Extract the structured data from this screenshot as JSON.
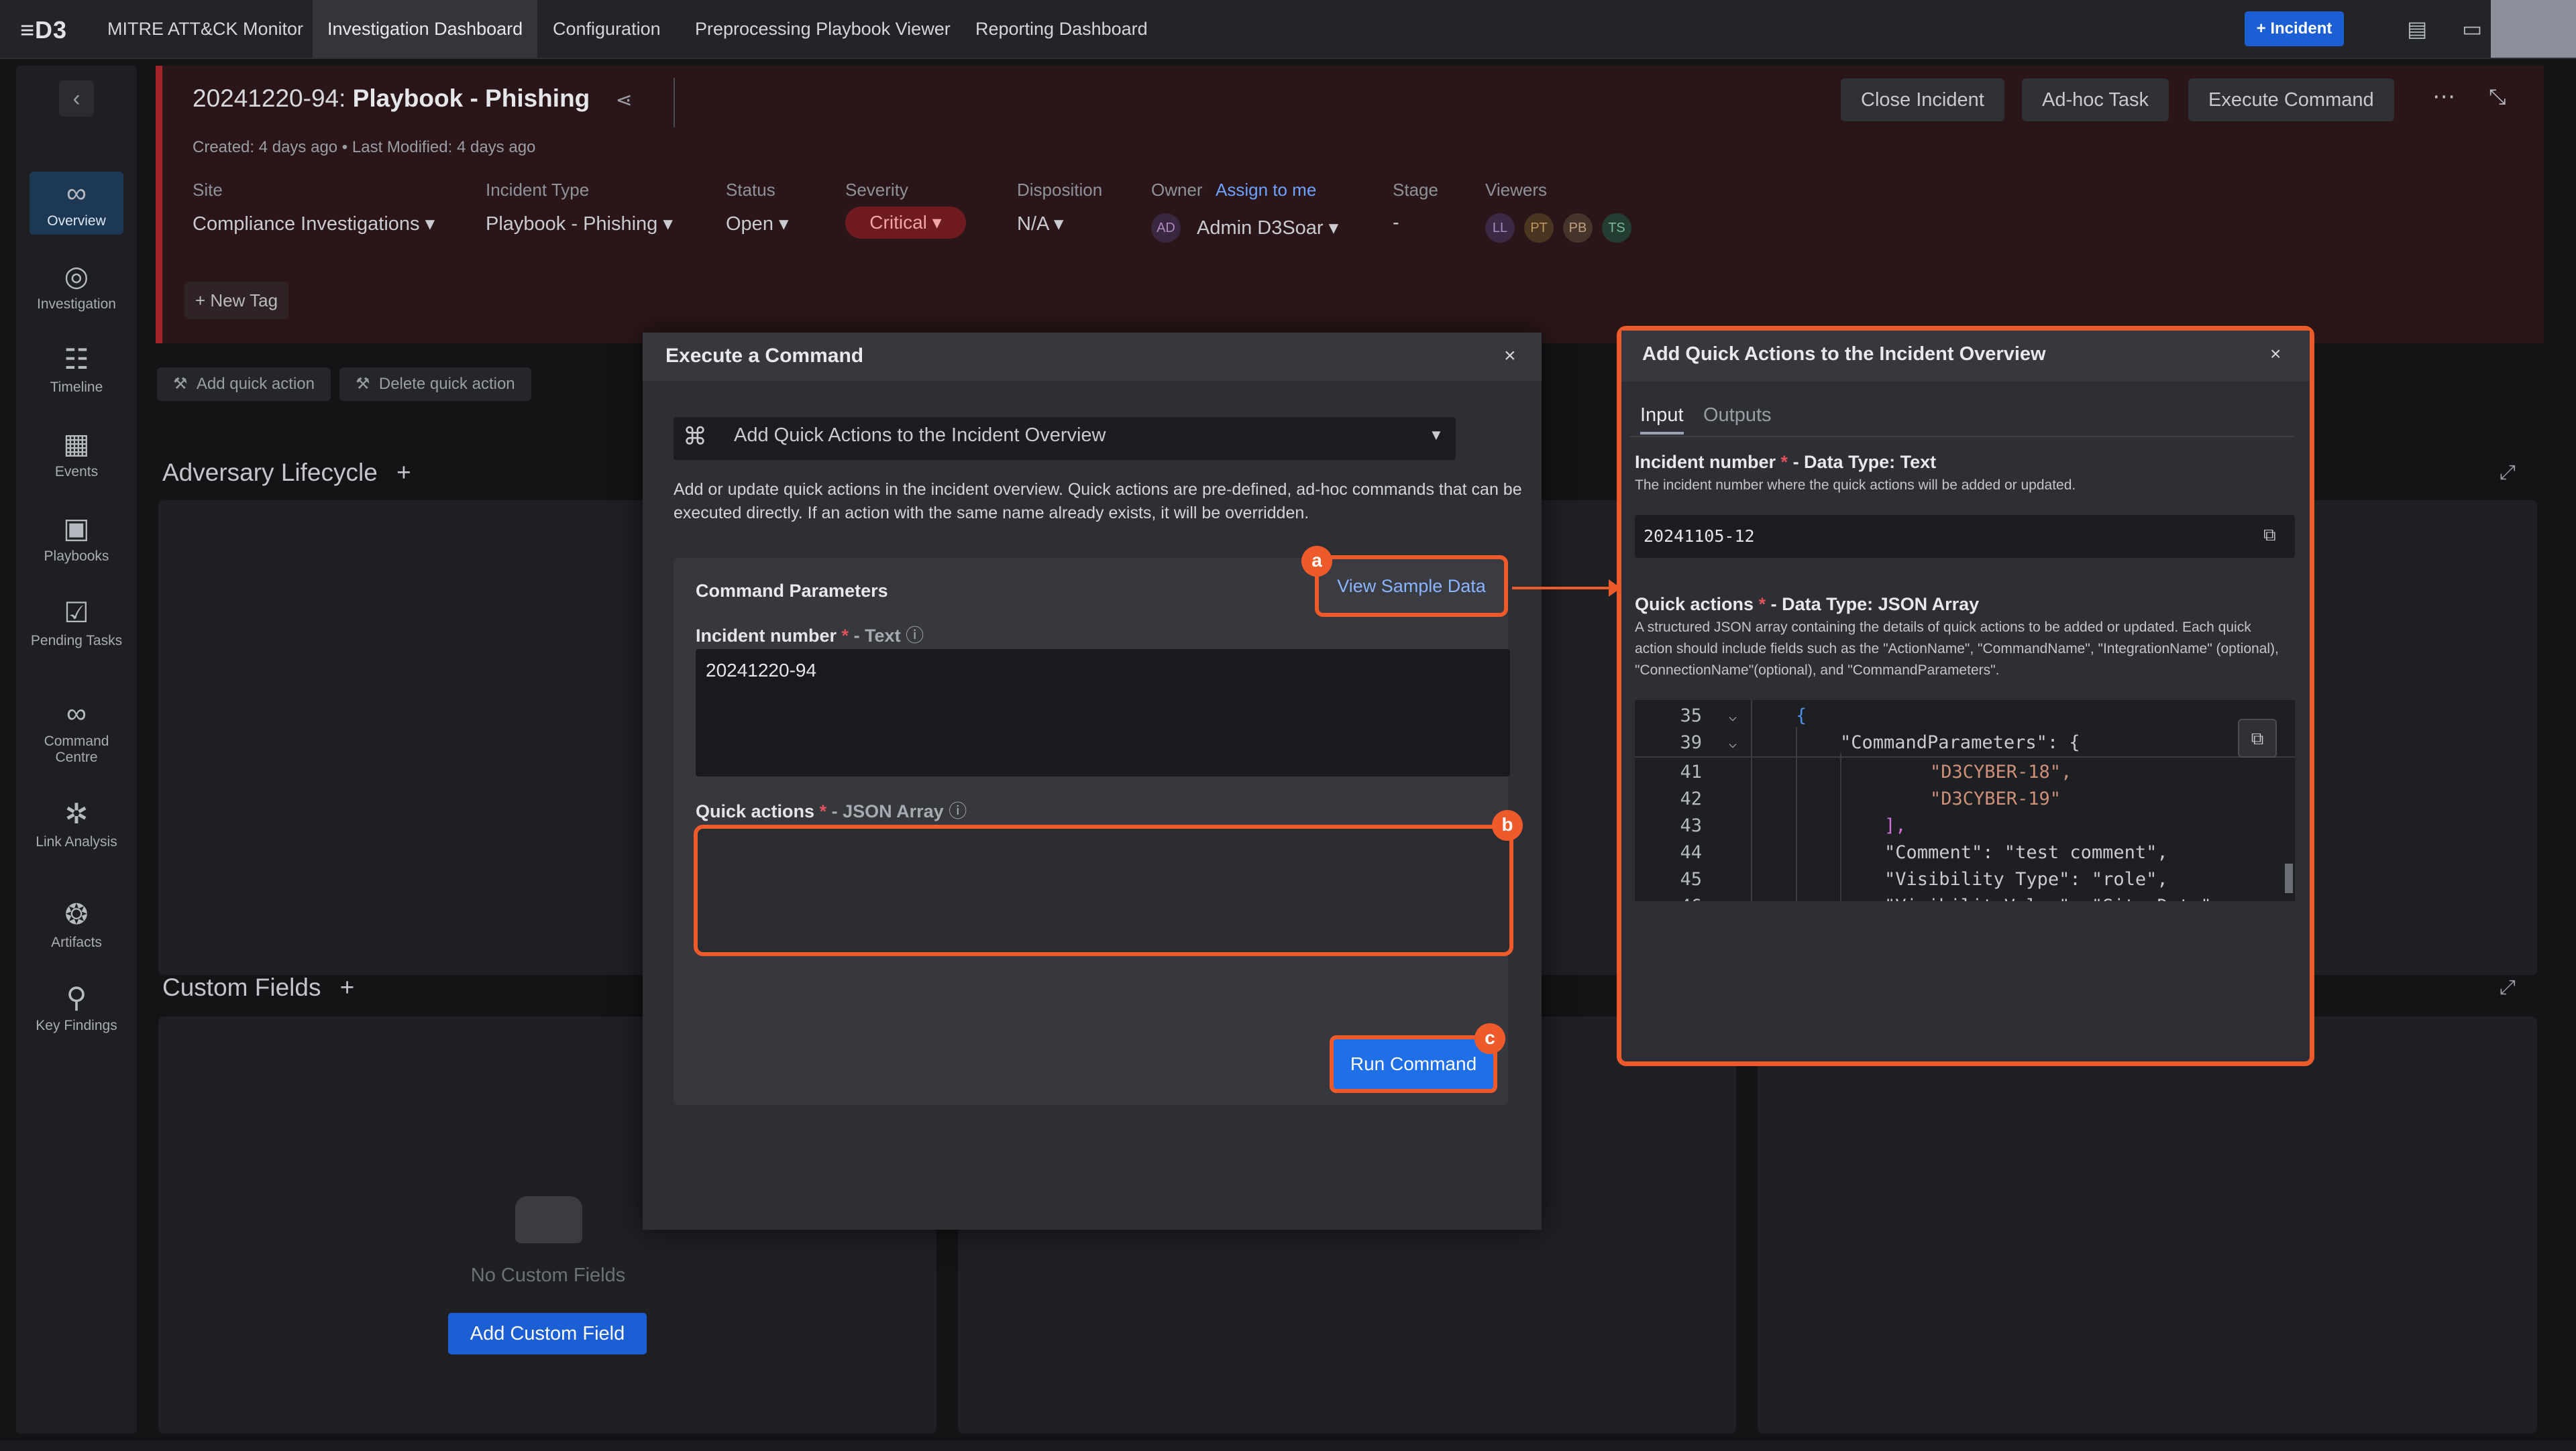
{
  "nav": {
    "logo": "≡D3",
    "tabs": [
      {
        "label": "MITRE ATT&CK Monitor"
      },
      {
        "label": "Investigation Dashboard"
      },
      {
        "label": "Configuration"
      },
      {
        "label": "Preprocessing Playbook Viewer"
      },
      {
        "label": "Reporting Dashboard"
      }
    ],
    "incident_button": "+ Incident"
  },
  "sidebar": {
    "items": [
      {
        "label": "Overview",
        "icon": "binoculars-icon"
      },
      {
        "label": "Investigation",
        "icon": "target-icon"
      },
      {
        "label": "Timeline",
        "icon": "timeline-icon"
      },
      {
        "label": "Events",
        "icon": "calendar-icon"
      },
      {
        "label": "Playbooks",
        "icon": "playbook-icon"
      },
      {
        "label": "Pending Tasks",
        "icon": "checklist-icon"
      },
      {
        "label": "Command Centre",
        "icon": "binoculars-icon"
      },
      {
        "label": "Link Analysis",
        "icon": "network-icon"
      },
      {
        "label": "Artifacts",
        "icon": "fingerprint-icon"
      },
      {
        "label": "Key Findings",
        "icon": "magnifier-icon"
      }
    ]
  },
  "incident": {
    "id": "20241220-94:",
    "name": "Playbook - Phishing",
    "created": "Created:  4 days ago  •  Last Modified:  4 days ago",
    "fields": {
      "site_label": "Site",
      "site_value": "Compliance Investigations",
      "type_label": "Incident Type",
      "type_value": "Playbook - Phishing",
      "status_label": "Status",
      "status_value": "Open",
      "severity_label": "Severity",
      "severity_value": "Critical",
      "disposition_label": "Disposition",
      "disposition_value": "N/A",
      "owner_label": "Owner",
      "assign_link": "Assign to me",
      "owner_initials": "AD",
      "owner_value": "Admin D3Soar",
      "stage_label": "Stage",
      "stage_value": "-",
      "viewers_label": "Viewers"
    },
    "viewers": [
      "LL",
      "PT",
      "PB",
      "TS"
    ],
    "buttons": {
      "close": "Close Incident",
      "adhoc": "Ad-hoc Task",
      "execute": "Execute Command"
    },
    "new_tag": "+ New Tag",
    "quick_actions": {
      "add": "Add quick action",
      "delete": "Delete quick action"
    }
  },
  "sections": {
    "adversary": "Adversary Lifecycle",
    "custom_fields": "Custom Fields",
    "no_custom_fields": "No Custom Fields",
    "add_custom_field": "Add Custom Field"
  },
  "execute_modal": {
    "title": "Execute a Command",
    "command": "Add Quick Actions to the Incident Overview",
    "description": "Add or update quick actions in the incident overview. Quick actions are pre-defined, ad-hoc commands that can be executed directly. If an action with the same name already exists, it will be overridden.",
    "params_title": "Command Parameters",
    "view_sample": "View Sample Data",
    "incident_label": "Incident number",
    "incident_type": "- Text",
    "incident_value": "20241220-94",
    "qa_label": "Quick actions",
    "qa_type": "- JSON Array",
    "run": "Run Command",
    "markers": [
      "a",
      "b",
      "c"
    ]
  },
  "qa_panel": {
    "title": "Add Quick Actions to the Incident Overview",
    "tabs": [
      "Input",
      "Outputs"
    ],
    "incident_label": "Incident number",
    "incident_type": "- Data Type: Text",
    "incident_desc": "The incident number where the quick actions will be added or updated.",
    "incident_value": "20241105-12",
    "qa_label": "Quick actions",
    "qa_type": "- Data Type: JSON Array",
    "qa_desc": "A structured JSON array containing the details of quick actions to be added or updated. Each quick action should include fields such as the \"ActionName\", \"CommandName\", \"IntegrationName\" (optional), \"ConnectionName\"(optional), and \"CommandParameters\".",
    "code_lines": [
      {
        "n": "35",
        "fold": true,
        "text": "{"
      },
      {
        "n": "39",
        "fold": true,
        "text": "\"CommandParameters\": {"
      },
      {
        "n": "41",
        "fold": false,
        "text": "\"D3CYBER-18\","
      },
      {
        "n": "42",
        "fold": false,
        "text": "\"D3CYBER-19\""
      },
      {
        "n": "43",
        "fold": false,
        "text": "],"
      },
      {
        "n": "44",
        "fold": false,
        "text": "\"Comment\": \"test comment\","
      },
      {
        "n": "45",
        "fold": false,
        "text": "\"Visibility Type\": \"role\","
      },
      {
        "n": "46",
        "fold": false,
        "text": "\"VisibilityValue\": \"Site_Data\""
      }
    ]
  },
  "colors": {
    "accent": "#1f6fe8",
    "highlight": "#ef5a2a",
    "critical": "#6e1a1f"
  }
}
